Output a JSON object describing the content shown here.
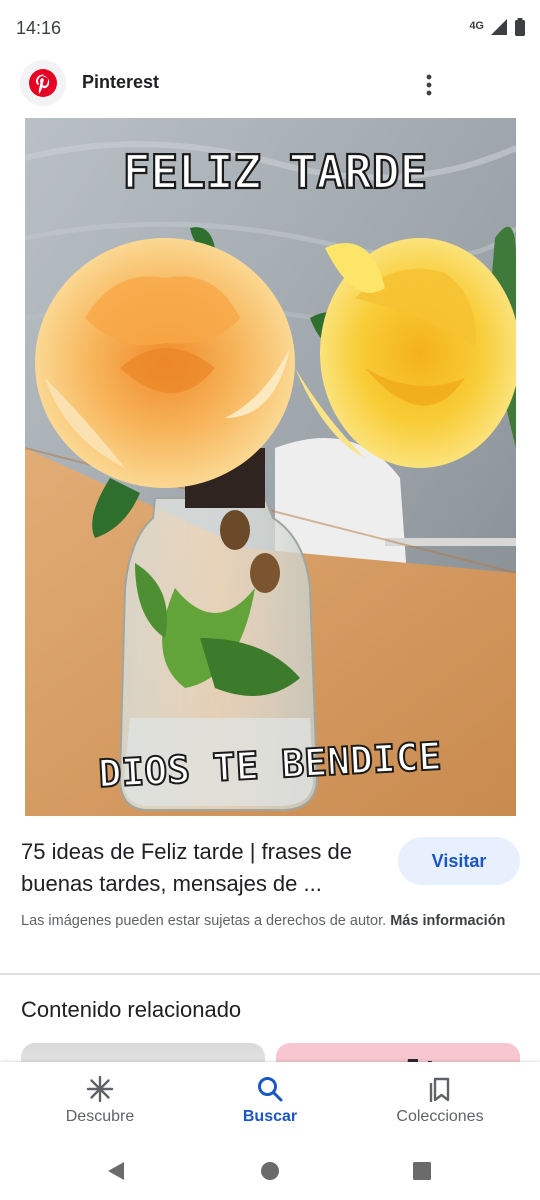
{
  "status_bar": {
    "time": "14:16",
    "network": "4G"
  },
  "header": {
    "site_name": "Pinterest",
    "logo_icon": "pinterest-logo-icon",
    "more_icon": "more-vert-icon"
  },
  "image": {
    "top_text": "FELIZ TARDE",
    "bottom_text": "DIOS TE BENDICE"
  },
  "result": {
    "title": "75 ideas de Feliz tarde | frases de buenas tardes, mensajes de ...",
    "visit_label": "Visitar",
    "copyright_text": "Las imágenes pueden estar sujetas a derechos de autor.",
    "more_info_label": "Más información"
  },
  "related": {
    "title": "Contenido relacionado"
  },
  "bottom_nav": {
    "items": [
      {
        "label": "Descubre",
        "icon": "asterisk-icon",
        "active": false
      },
      {
        "label": "Buscar",
        "icon": "search-icon",
        "active": true
      },
      {
        "label": "Colecciones",
        "icon": "collections-icon",
        "active": false
      }
    ]
  },
  "colors": {
    "accent": "#1a56c4",
    "visit_bg": "#e8f0fe",
    "pinterest_red": "#e60023"
  }
}
